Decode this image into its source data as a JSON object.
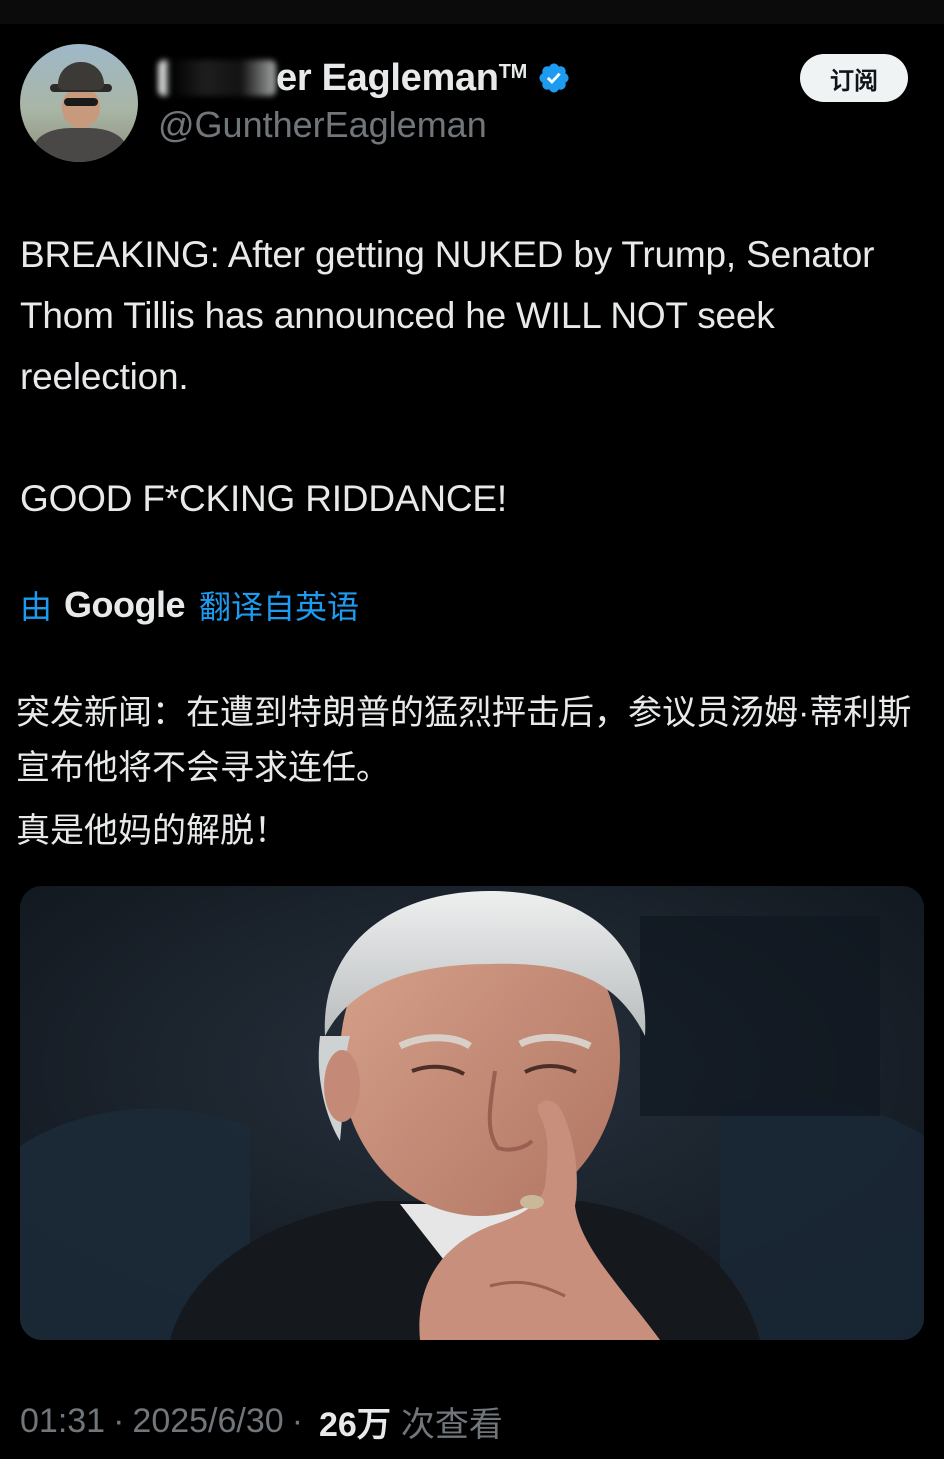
{
  "header": {
    "display_name_visible": "er Eagleman",
    "display_name_prefix_visible": "G",
    "trademark": "TM",
    "handle": "@GuntherEagleman",
    "subscribe_label": "订阅",
    "verified_icon": "verified-badge-icon",
    "avatar": "user-avatar-photo"
  },
  "tweet": {
    "text_lines": [
      "BREAKING: After getting NUKED by Trump, Senator Thom Tillis has announced he WILL NOT seek reelection.",
      "GOOD F*CKING RIDDANCE!"
    ],
    "translation_prefix": "由",
    "translation_provider": "Google",
    "translation_suffix": "翻译自英语",
    "translation_paragraphs": [
      "突发新闻：在遭到特朗普的猛烈抨击后，参议员汤姆·蒂利斯宣布他将不会寻求连任。",
      "真是他妈的解脱！"
    ],
    "media": "photo-senator-hand-on-chin"
  },
  "meta": {
    "time": "01:31",
    "date": "2025/6/30",
    "separator": "·",
    "views_count": "26万",
    "views_label": "次查看"
  },
  "colors": {
    "background": "#000000",
    "text": "#e7e9ea",
    "secondary": "#71767b",
    "link": "#1d9bf0",
    "verified": "#1d9bf0"
  }
}
